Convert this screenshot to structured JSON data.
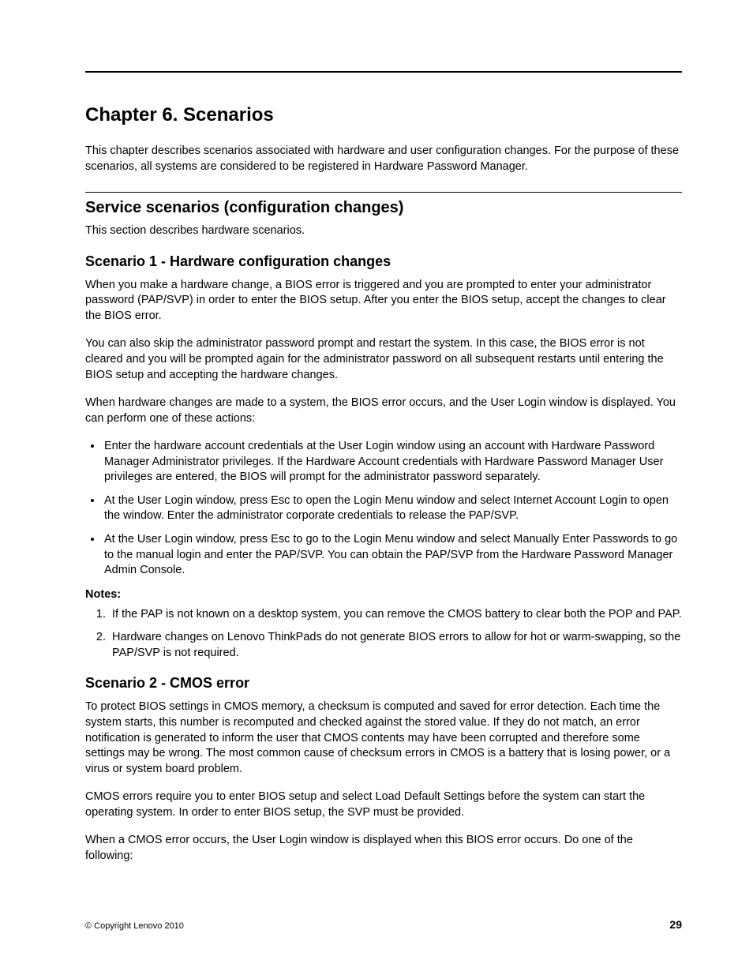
{
  "chapter_title": "Chapter 6.   Scenarios",
  "intro_para": "This chapter describes scenarios associated with hardware and user configuration changes. For the purpose of these scenarios, all systems are considered to be registered in Hardware Password Manager.",
  "section1": {
    "title": "Service scenarios (configuration changes)",
    "intro": "This section describes hardware scenarios."
  },
  "scenario1": {
    "title": "Scenario 1 - Hardware configuration changes",
    "p1": "When you make a hardware change, a BIOS error is triggered and you are prompted to enter your administrator password (PAP/SVP) in order to enter the BIOS setup. After you enter the BIOS setup, accept the changes to clear the BIOS error.",
    "p2": "You can also skip the administrator password prompt and restart the system. In this case, the BIOS error is not cleared and you will be prompted again for the administrator password on all subsequent restarts until entering the BIOS setup and accepting the hardware changes.",
    "p3": "When hardware changes are made to a system, the BIOS error occurs, and the User Login window is displayed. You can perform one of these actions:",
    "bullets": [
      "Enter the hardware account credentials at the User Login window using an account with Hardware Password Manager Administrator privileges. If the Hardware Account credentials with Hardware Password Manager User privileges are entered, the BIOS will prompt for the administrator password separately.",
      "At the User Login window, press Esc to open the Login Menu window and select Internet Account Login to open the window. Enter the administrator corporate credentials to release the PAP/SVP.",
      "At the User Login window, press Esc to go to the Login Menu window and select Manually Enter Passwords to go to the manual login and enter the PAP/SVP. You can obtain the PAP/SVP from the Hardware Password Manager Admin Console."
    ],
    "notes_label": "Notes:",
    "notes": [
      "If the PAP is not known on a desktop system, you can remove the CMOS battery to clear both the POP and PAP.",
      "Hardware changes on Lenovo ThinkPads do not generate BIOS errors to allow for hot or warm-swapping, so the PAP/SVP is not required."
    ]
  },
  "scenario2": {
    "title": "Scenario 2 - CMOS error",
    "p1": "To protect BIOS settings in CMOS memory, a checksum is computed and saved for error detection. Each time the system starts, this number is recomputed and checked against the stored value. If they do not match, an error notification is generated to inform the user that CMOS contents may have been corrupted and therefore some settings may be wrong. The most common cause of checksum errors in CMOS is a battery that is losing power, or a virus or system board problem.",
    "p2": "CMOS errors require you to enter BIOS setup and select Load Default Settings before the system can start the operating system. In order to enter BIOS setup, the SVP must be provided.",
    "p3": "When a CMOS error occurs, the User Login window is displayed when this BIOS error occurs. Do one of the following:"
  },
  "footer": {
    "copyright": "© Copyright Lenovo 2010",
    "page_number": "29"
  }
}
